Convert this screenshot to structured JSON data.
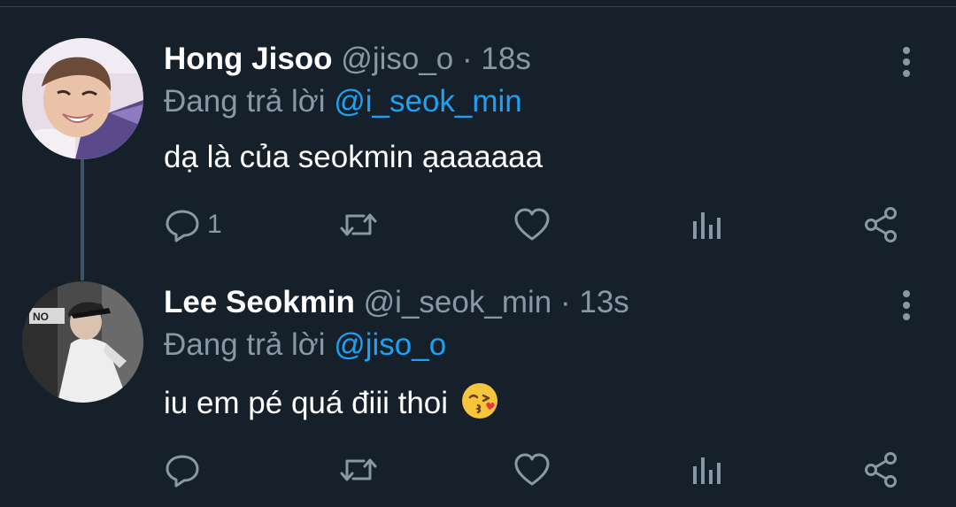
{
  "tweets": [
    {
      "name": "Hong Jisoo",
      "handle": "@jiso_o",
      "separator": "·",
      "time": "18s",
      "reply_prefix": "Đang trả lời",
      "reply_to": "@i_seok_min",
      "text": "dạ là của seokmin ạaaaaaa",
      "reply_count": "1"
    },
    {
      "name": "Lee Seokmin",
      "handle": "@i_seok_min",
      "separator": "·",
      "time": "13s",
      "reply_prefix": "Đang trả lời",
      "reply_to": "@jiso_o",
      "text": "iu em pé quá điii thoi",
      "emoji": "kissing-heart-emoji",
      "reply_count": ""
    }
  ],
  "icons": {
    "reply": "reply-icon",
    "retweet": "retweet-icon",
    "like": "heart-icon",
    "analytics": "analytics-icon",
    "share": "share-icon",
    "more": "more-vertical-icon"
  },
  "colors": {
    "background": "#15202b",
    "primary_text": "#ffffff",
    "secondary_text": "#8899a6",
    "link": "#1da1f2",
    "thread_line": "#3d5466"
  }
}
